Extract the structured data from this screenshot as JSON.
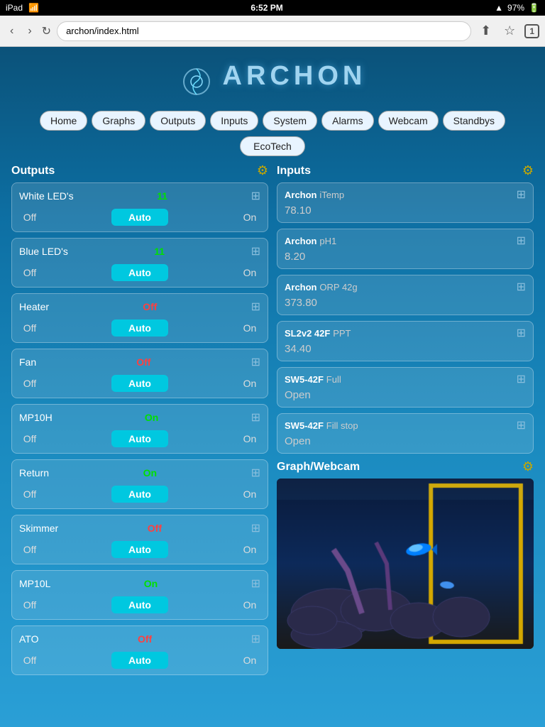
{
  "statusBar": {
    "left": "iPad ✦",
    "time": "6:52 PM",
    "battery": "97%",
    "signal": "▲"
  },
  "browser": {
    "url": "archon/index.html",
    "tabCount": "1"
  },
  "logo": {
    "text": "ARCHON"
  },
  "nav": {
    "items": [
      "Home",
      "Graphs",
      "Outputs",
      "Inputs",
      "System",
      "Alarms",
      "Webcam",
      "Standbys"
    ],
    "ecotech": "EcoTech"
  },
  "outputs": {
    "title": "Outputs",
    "items": [
      {
        "name": "White LED's",
        "value": "11",
        "valueClass": "value-green",
        "off": "Off",
        "auto": "Auto",
        "on": "On"
      },
      {
        "name": "Blue LED's",
        "value": "11",
        "valueClass": "value-green",
        "off": "Off",
        "auto": "Auto",
        "on": "On"
      },
      {
        "name": "Heater",
        "value": "Off",
        "valueClass": "value-red",
        "off": "Off",
        "auto": "Auto",
        "on": "On"
      },
      {
        "name": "Fan",
        "value": "Off",
        "valueClass": "value-red",
        "off": "Off",
        "auto": "Auto",
        "on": "On"
      },
      {
        "name": "MP10H",
        "value": "On",
        "valueClass": "value-green",
        "off": "Off",
        "auto": "Auto",
        "on": "On"
      },
      {
        "name": "Return",
        "value": "On",
        "valueClass": "value-green",
        "off": "Off",
        "auto": "Auto",
        "on": "On"
      },
      {
        "name": "Skimmer",
        "value": "Off",
        "valueClass": "value-red",
        "off": "Off",
        "auto": "Auto",
        "on": "On"
      },
      {
        "name": "MP10L",
        "value": "On",
        "valueClass": "value-green",
        "off": "Off",
        "auto": "Auto",
        "on": "On"
      },
      {
        "name": "ATO",
        "value": "Off",
        "valueClass": "value-red",
        "off": "Off",
        "auto": "Auto",
        "on": "On"
      }
    ]
  },
  "inputs": {
    "title": "Inputs",
    "items": [
      {
        "source": "Archon",
        "name": "iTemp",
        "value": "78.10"
      },
      {
        "source": "Archon",
        "name": "pH1",
        "value": "8.20"
      },
      {
        "source": "Archon",
        "name": "ORP 42g",
        "value": "373.80"
      },
      {
        "source": "SL2v2 42F",
        "name": "PPT",
        "value": "34.40"
      },
      {
        "source": "SW5-42F",
        "name": "Full",
        "value": "Open"
      },
      {
        "source": "SW5-42F",
        "name": "Fill stop",
        "value": "Open"
      }
    ]
  },
  "webcam": {
    "title": "Graph/Webcam"
  },
  "icons": {
    "gear": "⚙",
    "slider": "⊞",
    "back": "‹",
    "forward": "›",
    "refresh": "↻",
    "share": "↑",
    "bookmark": "☆",
    "wifi": "📶"
  }
}
